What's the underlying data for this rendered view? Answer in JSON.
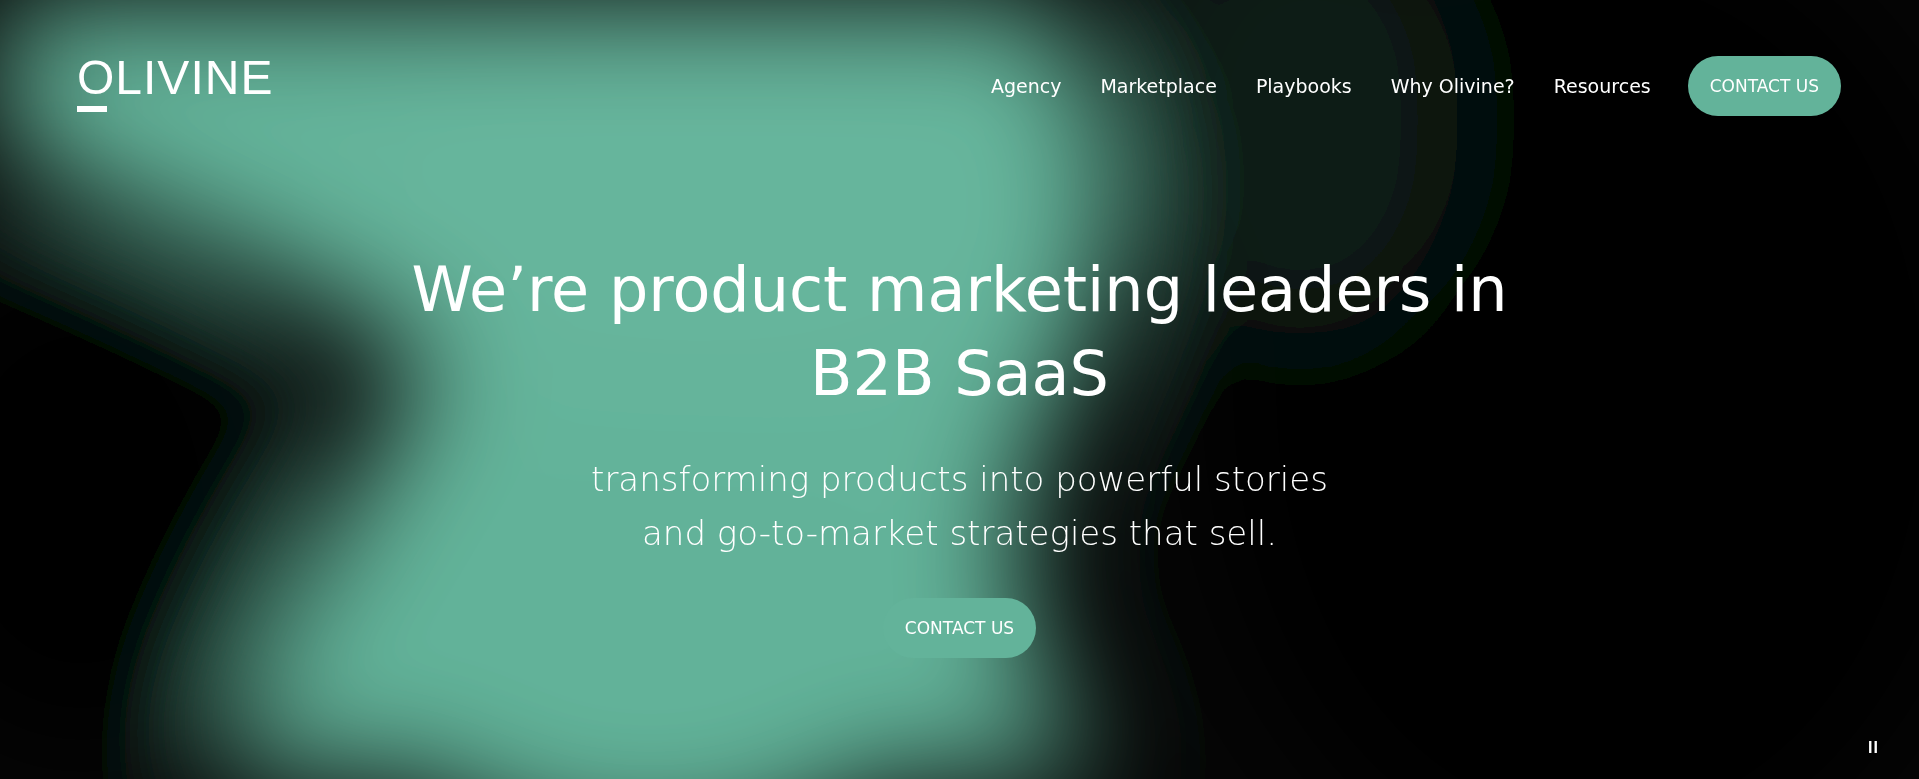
{
  "logo": {
    "text": "OLIVINE"
  },
  "nav": {
    "items": [
      {
        "label": "Agency"
      },
      {
        "label": "Marketplace"
      },
      {
        "label": "Playbooks"
      },
      {
        "label": "Why Olivine?"
      },
      {
        "label": "Resources"
      }
    ],
    "cta": "CONTACT US"
  },
  "hero": {
    "headline": "We’re product marketing leaders in B2B SaaS",
    "subtitle": "transforming products into powerful stories and go-to-market strategies that sell.",
    "cta": "CONTACT US",
    "pause": "II"
  }
}
